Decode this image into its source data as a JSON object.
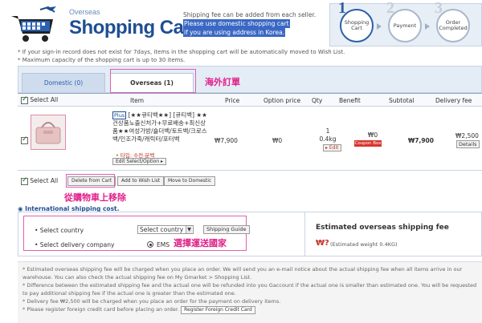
{
  "header": {
    "title_small": "Overseas",
    "title_big": "Shopping Cart",
    "note_line1": "Shipping fee can be added from each seller.",
    "note_hl1": "Please use domestic shopping cart",
    "note_hl2": "if you are using address in Korea."
  },
  "steps": [
    {
      "num": "1",
      "label1": "Shopping",
      "label2": "Cart"
    },
    {
      "num": "2",
      "label1": "Payment",
      "label2": ""
    },
    {
      "num": "3",
      "label1": "Order",
      "label2": "Completed"
    }
  ],
  "notes": [
    "* If your sign-in record does not exist for 7days, items in the shopping cart will be automatically moved to Wish List.",
    "* Maximum capacity of the shopping cart is up to 30 items."
  ],
  "tabs": {
    "domestic": "Domestic (0)",
    "overseas": "Overseas (1)"
  },
  "annotations": {
    "overseas_order": "海外訂單",
    "remove_from_cart": "從購物車上移除",
    "choose_country": "選擇運送國家"
  },
  "table": {
    "select_all": "Select All",
    "columns": [
      "Item",
      "Price",
      "Option price",
      "Qty",
      "Benefit",
      "Subtotal",
      "Delivery fee"
    ]
  },
  "item": {
    "plus": "Plus",
    "name": "[★★큐티백★★] [큐티백] ★★건상품노출신처가+무료배송+최신상품★★여성가방/숄더백/토트백/크로스백/인조가죽/캐릭터/포터백",
    "option": "• 타입: 수전-분백",
    "edit_option": "Edit Select/Option ▸",
    "price": "₩7,900",
    "option_price": "₩0",
    "qty": "1",
    "weight": "0.4kg",
    "qty_edit": "▸ Edit",
    "benefit": "₩0",
    "coupon": "Coupon Box",
    "subtotal": "₩7,900",
    "delivery_fee": "₩2,500",
    "details": "Details"
  },
  "actions": {
    "select_all": "Select All",
    "delete": "Delete from Cart",
    "wish": "Add to Wish List",
    "domestic": "Move to Domestic"
  },
  "shipping": {
    "title": "International shipping cost.",
    "country_label": "• Select country",
    "country_value": "Select country",
    "guide": "Shipping Guide",
    "company_label": "• Select delivery company",
    "company_value": "EMS",
    "est_title": "Estimated overseas shipping fee",
    "est_value": "₩?",
    "est_weight": "(Estimated weight 0.4KG)"
  },
  "bottom_notes": [
    "* Estimated overseas shipping fee will be charged when you place an order. We will send you an e-mail notice about the actual shipping fee when all items arrive in our warehouse. You can also check the actual shipping fee on My Gmarket > Shopping List.",
    "* Difference between the estimated shipping fee and the actual one will be refunded into you Gaccount if the actual one is smaller than estimated one. You will be requested to pay additional shipping fee if the actual one is greater than the estimated one.",
    "* Delivery fee ₩2,500 will be charged when you place an order for the payment on delivery items.",
    "* Please register foreign credit card before placing an order."
  ],
  "register_btn": "Register Foreign Credit Card"
}
